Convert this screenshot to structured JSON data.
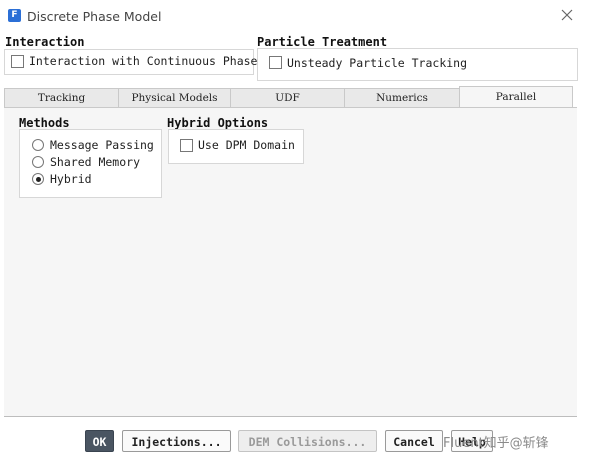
{
  "window": {
    "title": "Discrete Phase Model",
    "icon_glyph": "F",
    "close_icon": "close-icon"
  },
  "interaction": {
    "label": "Interaction",
    "checkbox_label": "Interaction with Continuous Phase",
    "checked": false
  },
  "particle_treatment": {
    "label": "Particle Treatment",
    "checkbox_label": "Unsteady Particle Tracking",
    "checked": false
  },
  "tabs": [
    {
      "label": "Tracking",
      "active": false
    },
    {
      "label": "Physical Models",
      "active": false
    },
    {
      "label": "UDF",
      "active": false
    },
    {
      "label": "Numerics",
      "active": false
    },
    {
      "label": "Parallel",
      "active": true
    }
  ],
  "methods": {
    "label": "Methods",
    "options": [
      {
        "label": "Message Passing",
        "selected": false
      },
      {
        "label": "Shared Memory",
        "selected": false
      },
      {
        "label": "Hybrid",
        "selected": true
      }
    ]
  },
  "hybrid_options": {
    "label": "Hybrid Options",
    "checkbox_label": "Use DPM Domain",
    "checked": false
  },
  "buttons": {
    "ok": "OK",
    "injections": "Injections...",
    "dem_collisions": "DEM Collisions...",
    "cancel": "Cancel",
    "help": "Help"
  },
  "watermark": "Fluent知乎@斩锋",
  "colors": {
    "accent": "#2b6fd6",
    "primary_button": "#4a5562",
    "panel": "#f6f6f6"
  }
}
